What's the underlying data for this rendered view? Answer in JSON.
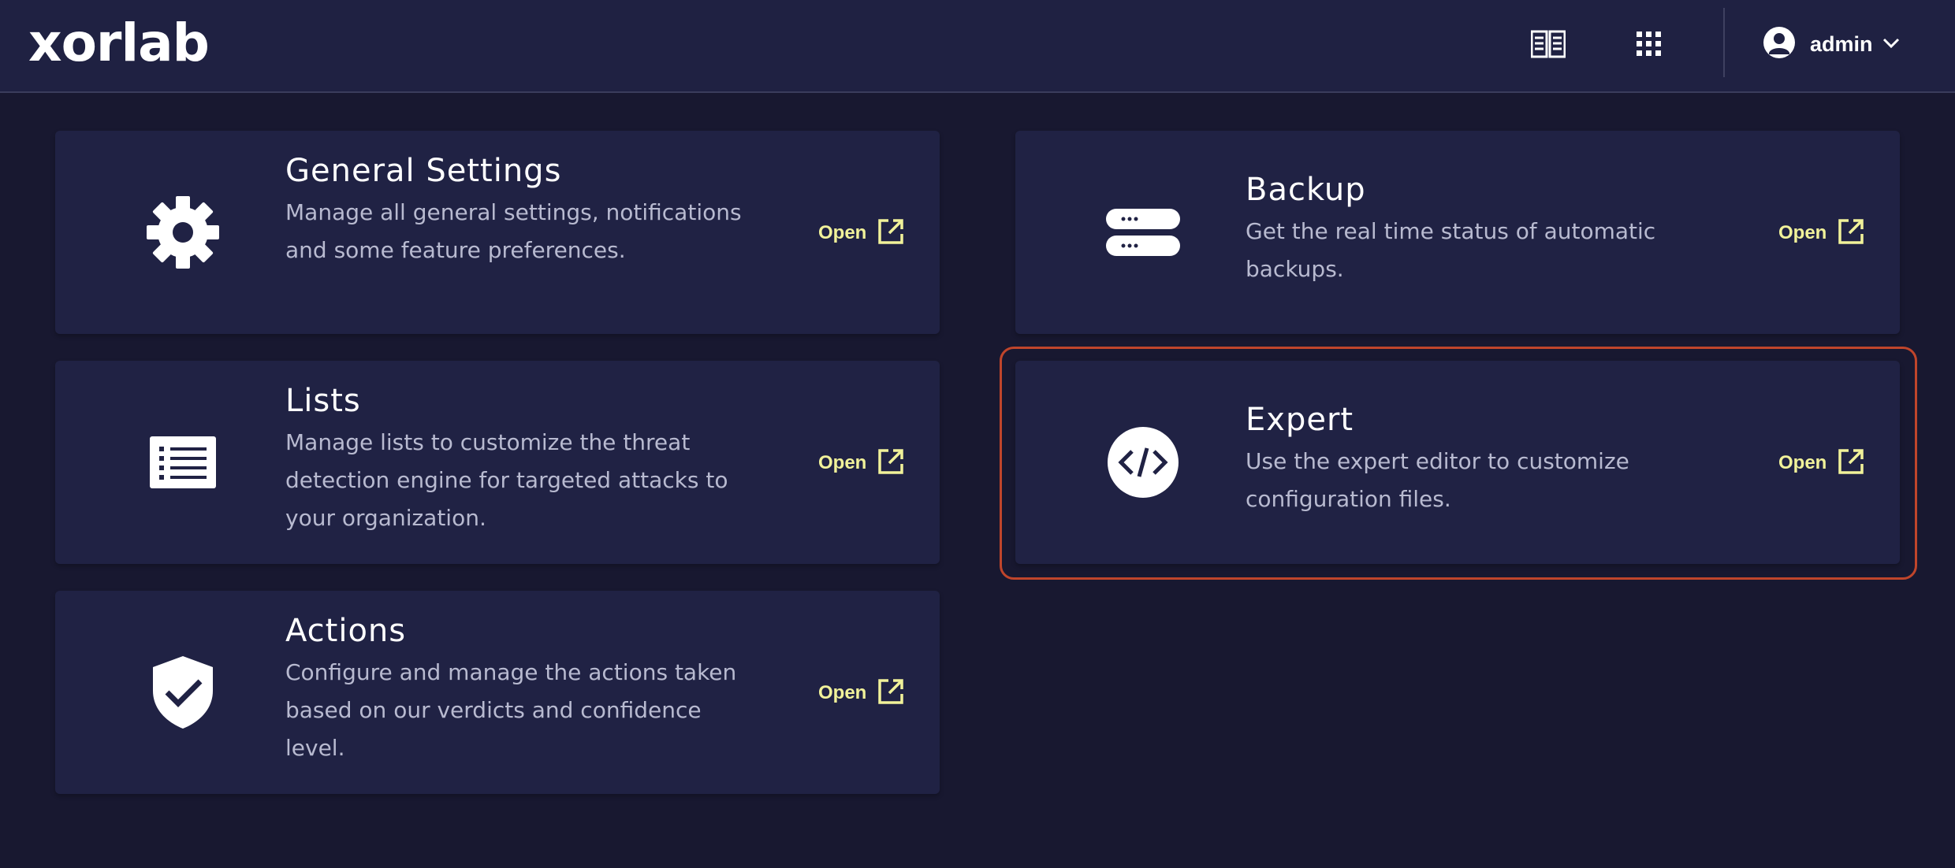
{
  "header": {
    "logo_text": "xorlab",
    "docs_icon": "book-open-icon",
    "apps_icon": "grid-dots-icon",
    "user": {
      "name": "admin",
      "avatar_icon": "user-circle-icon",
      "chevron_icon": "chevron-down-icon"
    }
  },
  "cards": [
    {
      "id": "general-settings",
      "title": "General Settings",
      "description": "Manage all general settings, notifications and some feature preferences.",
      "icon": "gear-icon",
      "open_label": "Open"
    },
    {
      "id": "lists",
      "title": "Lists",
      "description": "Manage lists to customize the threat detection engine for targeted attacks to your organization.",
      "icon": "list-icon",
      "open_label": "Open"
    },
    {
      "id": "actions",
      "title": "Actions",
      "description": "Configure and manage the actions taken based on our verdicts and confidence level.",
      "icon": "shield-check-icon",
      "open_label": "Open"
    },
    {
      "id": "backup",
      "title": "Backup",
      "description": "Get the real time status of automatic backups.",
      "icon": "server-icon",
      "open_label": "Open"
    },
    {
      "id": "expert",
      "title": "Expert",
      "description": "Use the expert editor to customize configuration files.",
      "icon": "code-icon",
      "open_label": "Open",
      "highlighted": true
    }
  ],
  "colors": {
    "background": "#181830",
    "card": "#202244",
    "header": "#1f2142",
    "open_accent": "#f1f29a",
    "highlight_border": "#c0452b"
  }
}
